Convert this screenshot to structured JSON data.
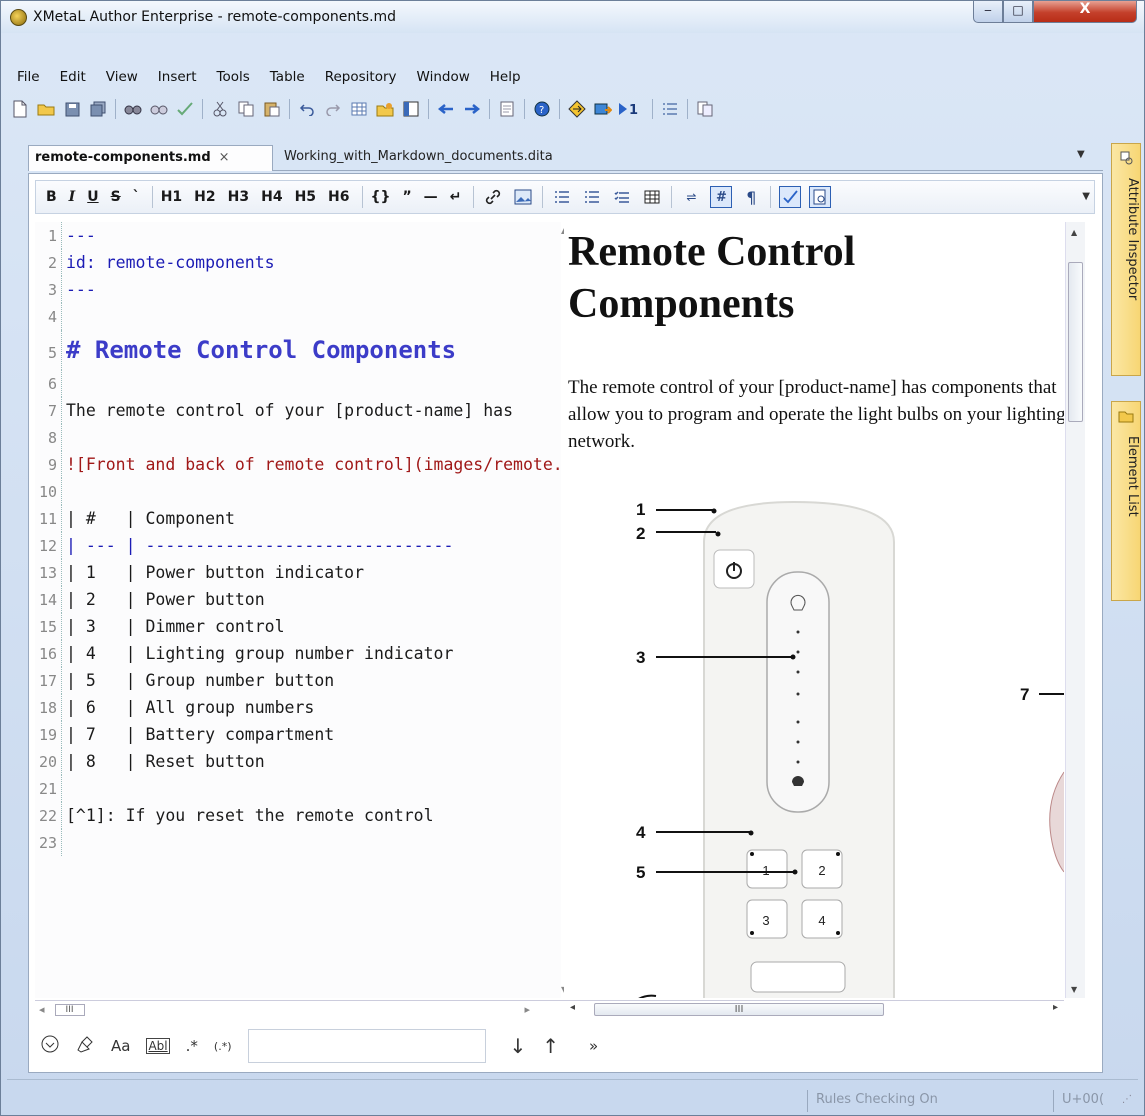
{
  "window": {
    "title": "XMetaL Author Enterprise - remote-components.md",
    "min_label": "‒",
    "max_label": "□",
    "close_label": "X"
  },
  "menu": [
    "File",
    "Edit",
    "View",
    "Insert",
    "Tools",
    "Table",
    "Repository",
    "Window",
    "Help"
  ],
  "tabs": {
    "active": "remote-components.md",
    "inactive": "Working_with_Markdown_documents.dita",
    "close": "×"
  },
  "format_toolbar": {
    "bold": "B",
    "italic": "I",
    "underline": "U",
    "strike": "S",
    "headings": [
      "H1",
      "H2",
      "H3",
      "H4",
      "H5",
      "H6"
    ],
    "code": "{}",
    "quote": "”",
    "hr": "—",
    "break": "↵",
    "pilcrow": "¶",
    "hash": "#"
  },
  "code": {
    "lines": [
      {
        "n": "1",
        "text": "---"
      },
      {
        "n": "2",
        "text": "id: remote-components"
      },
      {
        "n": "3",
        "text": "---"
      },
      {
        "n": "4",
        "text": ""
      },
      {
        "n": "5",
        "text": "# Remote Control Components"
      },
      {
        "n": "6",
        "text": ""
      },
      {
        "n": "7",
        "text": "The remote control of your [product-name] has"
      },
      {
        "n": "8",
        "text": ""
      },
      {
        "n": "9",
        "text": "![Front and back of remote control](images/remote.png)"
      },
      {
        "n": "10",
        "text": ""
      },
      {
        "n": "11",
        "text": "| #   | Component"
      },
      {
        "n": "12",
        "text": "| --- | -------------------------------"
      },
      {
        "n": "13",
        "text": "| 1   | Power button indicator"
      },
      {
        "n": "14",
        "text": "| 2   | Power button"
      },
      {
        "n": "15",
        "text": "| 3   | Dimmer control"
      },
      {
        "n": "16",
        "text": "| 4   | Lighting group number indicator"
      },
      {
        "n": "17",
        "text": "| 5   | Group number button"
      },
      {
        "n": "18",
        "text": "| 6   | All group numbers"
      },
      {
        "n": "19",
        "text": "| 7   | Battery compartment"
      },
      {
        "n": "20",
        "text": "| 8   | Reset button"
      },
      {
        "n": "21",
        "text": ""
      },
      {
        "n": "22",
        "text": "[^1]: If you reset the remote control"
      },
      {
        "n": "23",
        "text": ""
      }
    ]
  },
  "preview": {
    "title": "Remote Control Components",
    "paragraph": "The remote control of your [product-name] has components that allow you to program and operate the light bulbs on your lighting network.",
    "callouts": [
      "1",
      "2",
      "3",
      "4",
      "5",
      "7"
    ],
    "keys": [
      "1",
      "2",
      "3",
      "4"
    ]
  },
  "side_panels": {
    "attribute_inspector": "Attribute Inspector",
    "element_list": "Element List"
  },
  "findbar": {
    "case_label": "Aa",
    "word_label": "Abl",
    "wildcard_label": ".*",
    "regex_label": "(.*)",
    "down": "↓",
    "up": "↑",
    "more": "»",
    "search_value": ""
  },
  "status": {
    "rules": "Rules Checking On",
    "unicode": "U+00("
  },
  "colors": {
    "accent": "#2c5fb3",
    "side_tab": "#f7d674",
    "code_heading": "#3c3cc8",
    "code_link": "#a01818"
  }
}
